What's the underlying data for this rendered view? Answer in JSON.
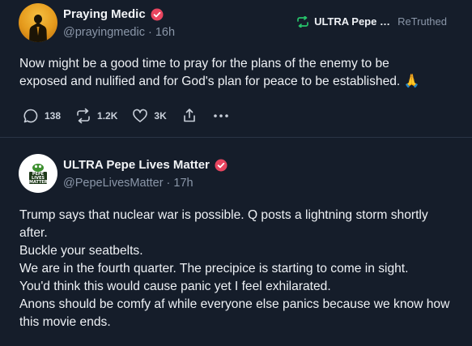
{
  "post1": {
    "author_name": "Praying Medic",
    "handle_time": "@prayingmedic · 16h",
    "retruth": {
      "by_name": "ULTRA Pepe Li...",
      "label": "ReTruthed"
    },
    "text": "Now might be a good time to pray for the plans of the enemy to be exposed and nulified and for God's plan for peace to be established.",
    "emoji": "🙏",
    "actions": {
      "replies": "138",
      "retruths": "1.2K",
      "likes": "3K"
    }
  },
  "post2": {
    "author_name": "ULTRA Pepe Lives Matter",
    "handle_time": "@PepeLivesMatter · 17h",
    "avatar_text": "PEPE LIVES MATTER",
    "lines": [
      "Trump says that nuclear war is possible. Q posts a lightning storm shortly after.",
      "Buckle your seatbelts.",
      "We are in the fourth quarter. The precipice is starting to come in sight.",
      "You'd think this would cause panic yet I feel exhilarated.",
      "Anons should be comfy af while everyone else panics because we know how this movie ends."
    ]
  },
  "colors": {
    "background": "#151d2a",
    "verified_badge": "#e8455f",
    "retruth_icon": "#27c36a"
  }
}
